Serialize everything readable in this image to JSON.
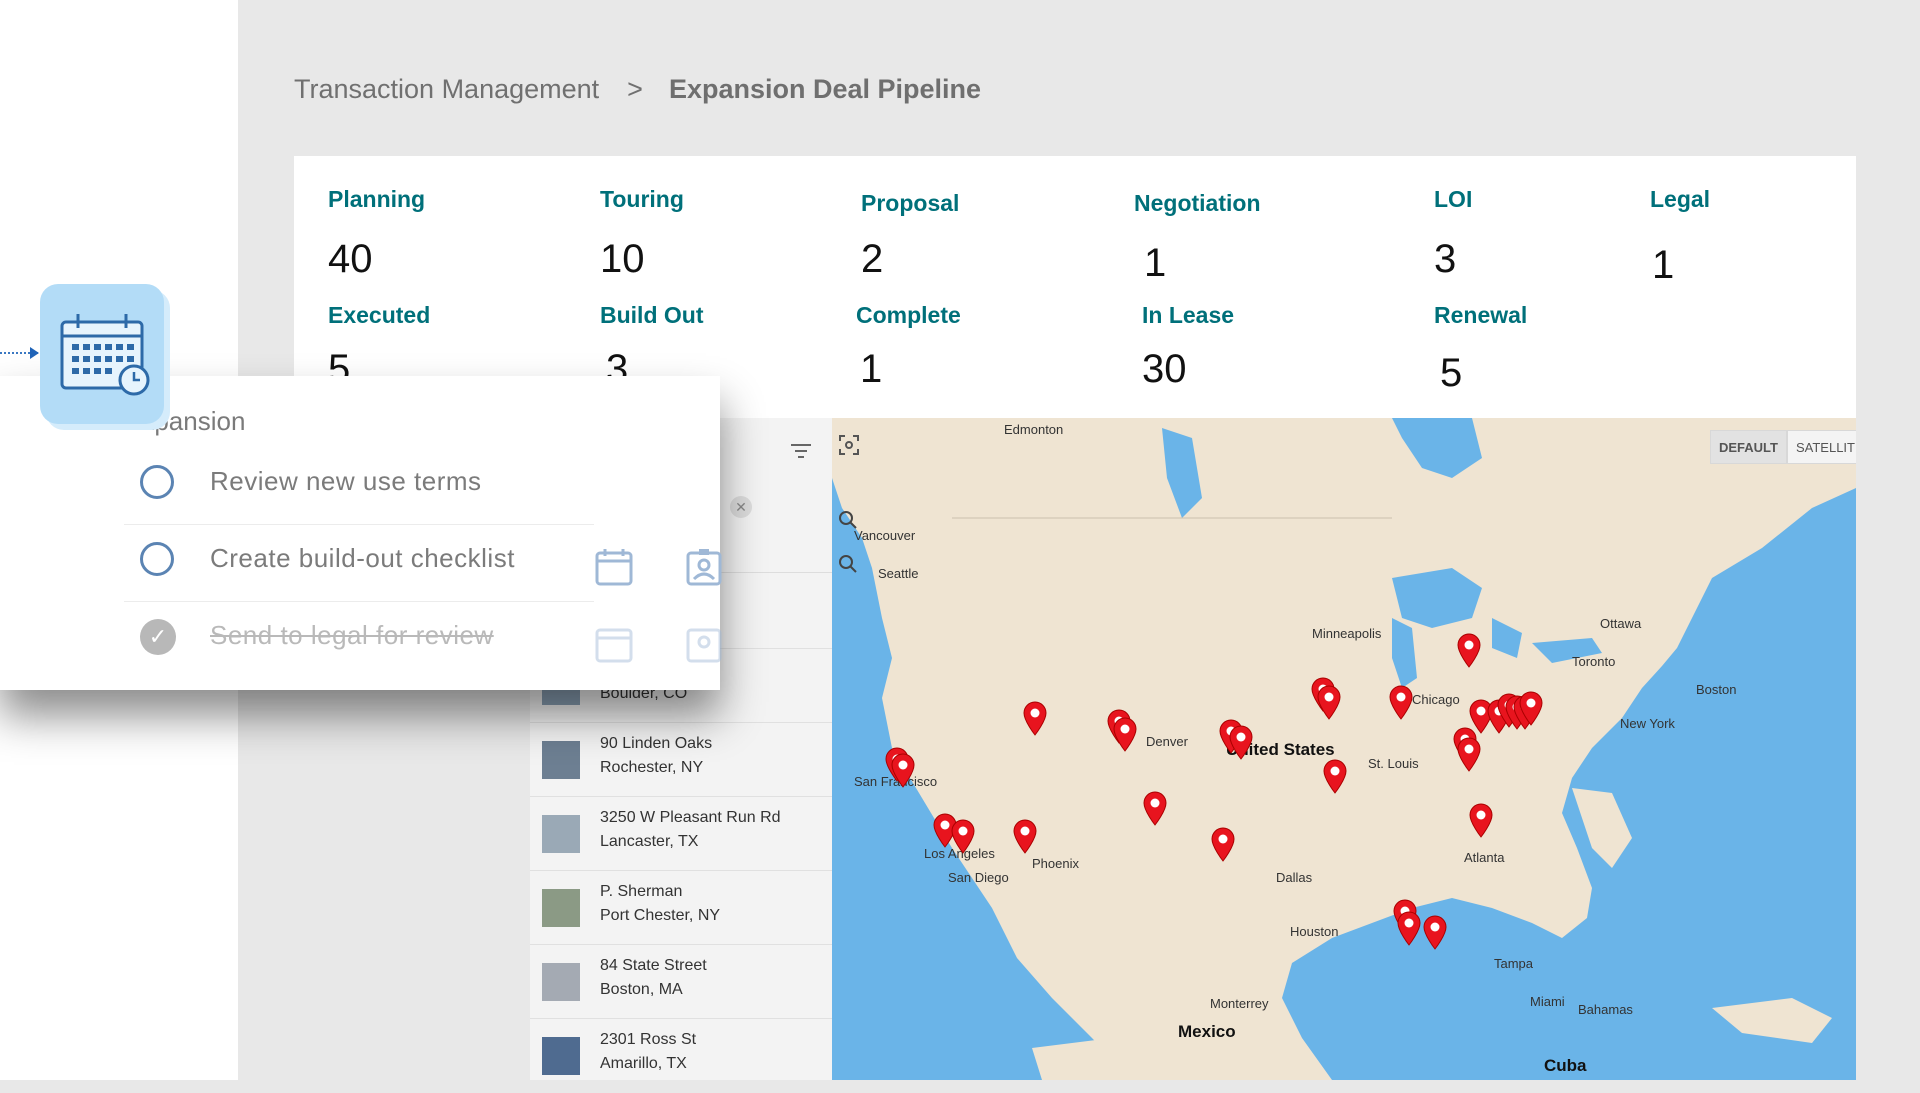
{
  "breadcrumb": {
    "parent": "Transaction Management",
    "separator": ">",
    "current": "Expansion Deal Pipeline"
  },
  "stats": [
    {
      "label": "Planning",
      "value": "40"
    },
    {
      "label": "Touring",
      "value": "10"
    },
    {
      "label": "Proposal",
      "value": "2"
    },
    {
      "label": "Negotiation",
      "value": "1"
    },
    {
      "label": "LOI",
      "value": "3"
    },
    {
      "label": "Legal",
      "value": "1"
    },
    {
      "label": "Executed",
      "value": "5"
    },
    {
      "label": "Build Out",
      "value": "3"
    },
    {
      "label": "Complete",
      "value": "1"
    },
    {
      "label": "In Lease",
      "value": "30"
    },
    {
      "label": "Renewal",
      "value": "5"
    }
  ],
  "checklist": {
    "title": "Expansion",
    "tasks": [
      {
        "text": "Review new use terms",
        "done": false
      },
      {
        "text": "Create build-out checklist",
        "done": false
      },
      {
        "text": "Send to legal for review",
        "done": true
      }
    ]
  },
  "properties": [
    {
      "line1": "",
      "line2": "Boulder, CO"
    },
    {
      "line1": "90 Linden Oaks",
      "line2": "Rochester, NY"
    },
    {
      "line1": "3250 W Pleasant Run Rd",
      "line2": "Lancaster, TX"
    },
    {
      "line1": "P. Sherman",
      "line2": "Port Chester, NY"
    },
    {
      "line1": "84 State Street",
      "line2": "Boston, MA"
    },
    {
      "line1": "2301 Ross St",
      "line2": "Amarillo, TX"
    }
  ],
  "map": {
    "toggle": {
      "default": "DEFAULT",
      "satellite": "SATELLITE"
    },
    "cities": {
      "edmonton": "Edmonton",
      "vancouver": "Vancouver",
      "seattle": "Seattle",
      "minneapolis": "Minneapolis",
      "ottawa": "Ottawa",
      "toronto": "Toronto",
      "chicago": "Chicago",
      "us": "United States",
      "stlouis": "St. Louis",
      "denver": "Denver",
      "sanfrancisco": "San Francisco",
      "losangeles": "Los Angeles",
      "sandiego": "San Diego",
      "phoenix": "Phoenix",
      "dallas": "Dallas",
      "atlanta": "Atlanta",
      "houston": "Houston",
      "newyork": "New York",
      "boston": "Boston",
      "tampa": "Tampa",
      "miami": "Miami",
      "bahamas": "Bahamas",
      "monterrey": "Monterrey",
      "mexico": "Mexico",
      "cuba": "Cuba"
    },
    "water_color": "#6ab4e8",
    "land_color": "#efe4d2",
    "pin_color": "#e8141e"
  }
}
